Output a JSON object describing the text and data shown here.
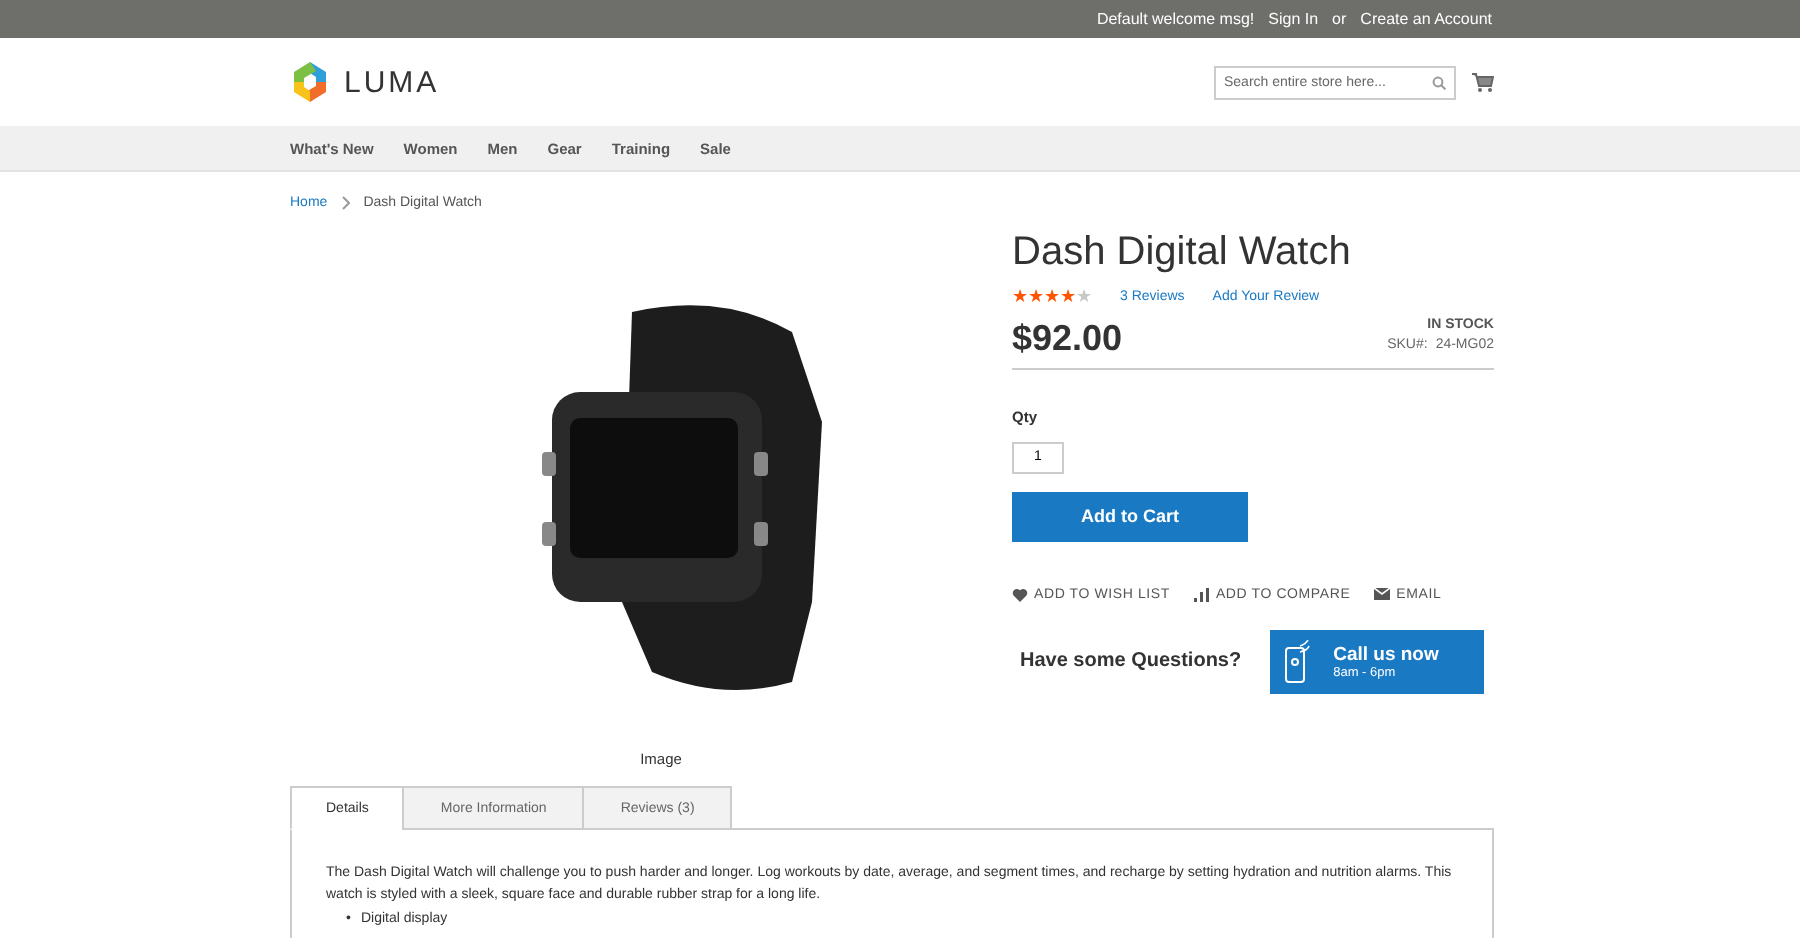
{
  "top_bar": {
    "welcome": "Default welcome msg!",
    "sign_in": "Sign In",
    "or": "or",
    "create_account": "Create an Account"
  },
  "header": {
    "logo_text": "LUMA",
    "search": {
      "placeholder": "Search entire store here..."
    }
  },
  "nav": [
    "What's New",
    "Women",
    "Men",
    "Gear",
    "Training",
    "Sale"
  ],
  "breadcrumb": [
    {
      "label": "Home",
      "link": true
    },
    {
      "label": "Dash Digital Watch",
      "link": false
    }
  ],
  "gallery": {
    "caption": "Image"
  },
  "product": {
    "title": "Dash Digital Watch",
    "stars": 4,
    "reviews": "3  Reviews",
    "add_review": "Add Your Review",
    "price": "$92.00",
    "stock": "IN STOCK",
    "sku_label": "SKU#:",
    "sku": "24-MG02",
    "qty_label": "Qty",
    "qty": "1",
    "add_to_cart": "Add to Cart",
    "actions": [
      {
        "kind": "wishlist",
        "label": "ADD TO WISH LIST"
      },
      {
        "kind": "compare",
        "label": "ADD TO COMPARE"
      },
      {
        "kind": "email",
        "label": "EMAIL"
      }
    ],
    "questions": "Have some Questions?",
    "call_title": "Call us now",
    "call_hours": "8am - 6pm"
  },
  "tabs": [
    {
      "label": "Details",
      "selected": true
    },
    {
      "label": "More Information",
      "selected": false
    },
    {
      "label": "Reviews (3)",
      "selected": false
    }
  ],
  "description": {
    "text": "The Dash Digital Watch will challenge you to push harder and longer. Log workouts by date, average, and segment times, and recharge by setting hydration and nutrition alarms. This watch is styled with a sleek, square face and durable rubber strap for a long life.",
    "bullets": [
      {
        "marker": "•",
        "text": "Digital display"
      }
    ]
  }
}
